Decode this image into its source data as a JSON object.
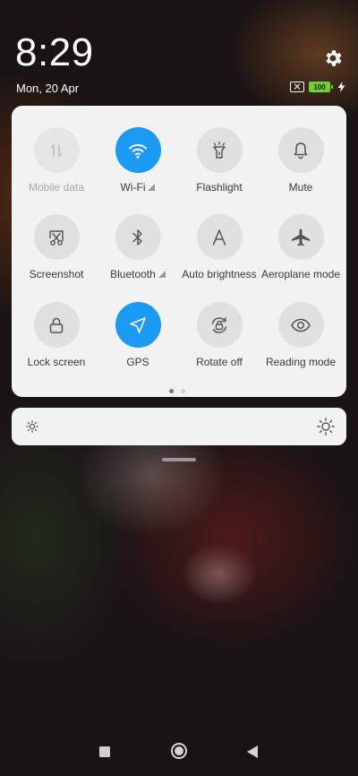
{
  "status_bar": {
    "time": "8:29",
    "date": "Mon, 20 Apr",
    "battery_level": "100",
    "icons": [
      "settings-gear-icon",
      "no-sim-icon",
      "battery-icon",
      "charging-bolt-icon"
    ]
  },
  "quick_settings": {
    "tiles": [
      {
        "label": "Mobile data",
        "icon": "mobile-data-arrows-icon",
        "state": "disabled"
      },
      {
        "label": "Wi-Fi",
        "icon": "wifi-icon",
        "state": "active",
        "has_expand": true
      },
      {
        "label": "Flashlight",
        "icon": "flashlight-icon",
        "state": "off"
      },
      {
        "label": "Mute",
        "icon": "bell-icon",
        "state": "off"
      },
      {
        "label": "Screenshot",
        "icon": "scissors-icon",
        "state": "off"
      },
      {
        "label": "Bluetooth",
        "icon": "bluetooth-icon",
        "state": "off",
        "has_expand": true
      },
      {
        "label": "Auto brightness",
        "icon": "letter-a-icon",
        "state": "off"
      },
      {
        "label": "Aeroplane mode",
        "icon": "airplane-icon",
        "state": "off"
      },
      {
        "label": "Lock screen",
        "icon": "lock-icon",
        "state": "off"
      },
      {
        "label": "GPS",
        "icon": "location-arrow-icon",
        "state": "active"
      },
      {
        "label": "Rotate off",
        "icon": "rotate-lock-icon",
        "state": "off"
      },
      {
        "label": "Reading mode",
        "icon": "eye-icon",
        "state": "off"
      }
    ],
    "page_count": 2,
    "current_page": 1
  },
  "brightness": {
    "icons": [
      "brightness-low-icon",
      "brightness-high-icon"
    ]
  },
  "colors": {
    "accent": "#1a9af5",
    "panel": "#f2f2f2",
    "battery": "#6fd12a"
  },
  "navigation": {
    "buttons": [
      "recents-button",
      "home-button",
      "back-button"
    ]
  }
}
